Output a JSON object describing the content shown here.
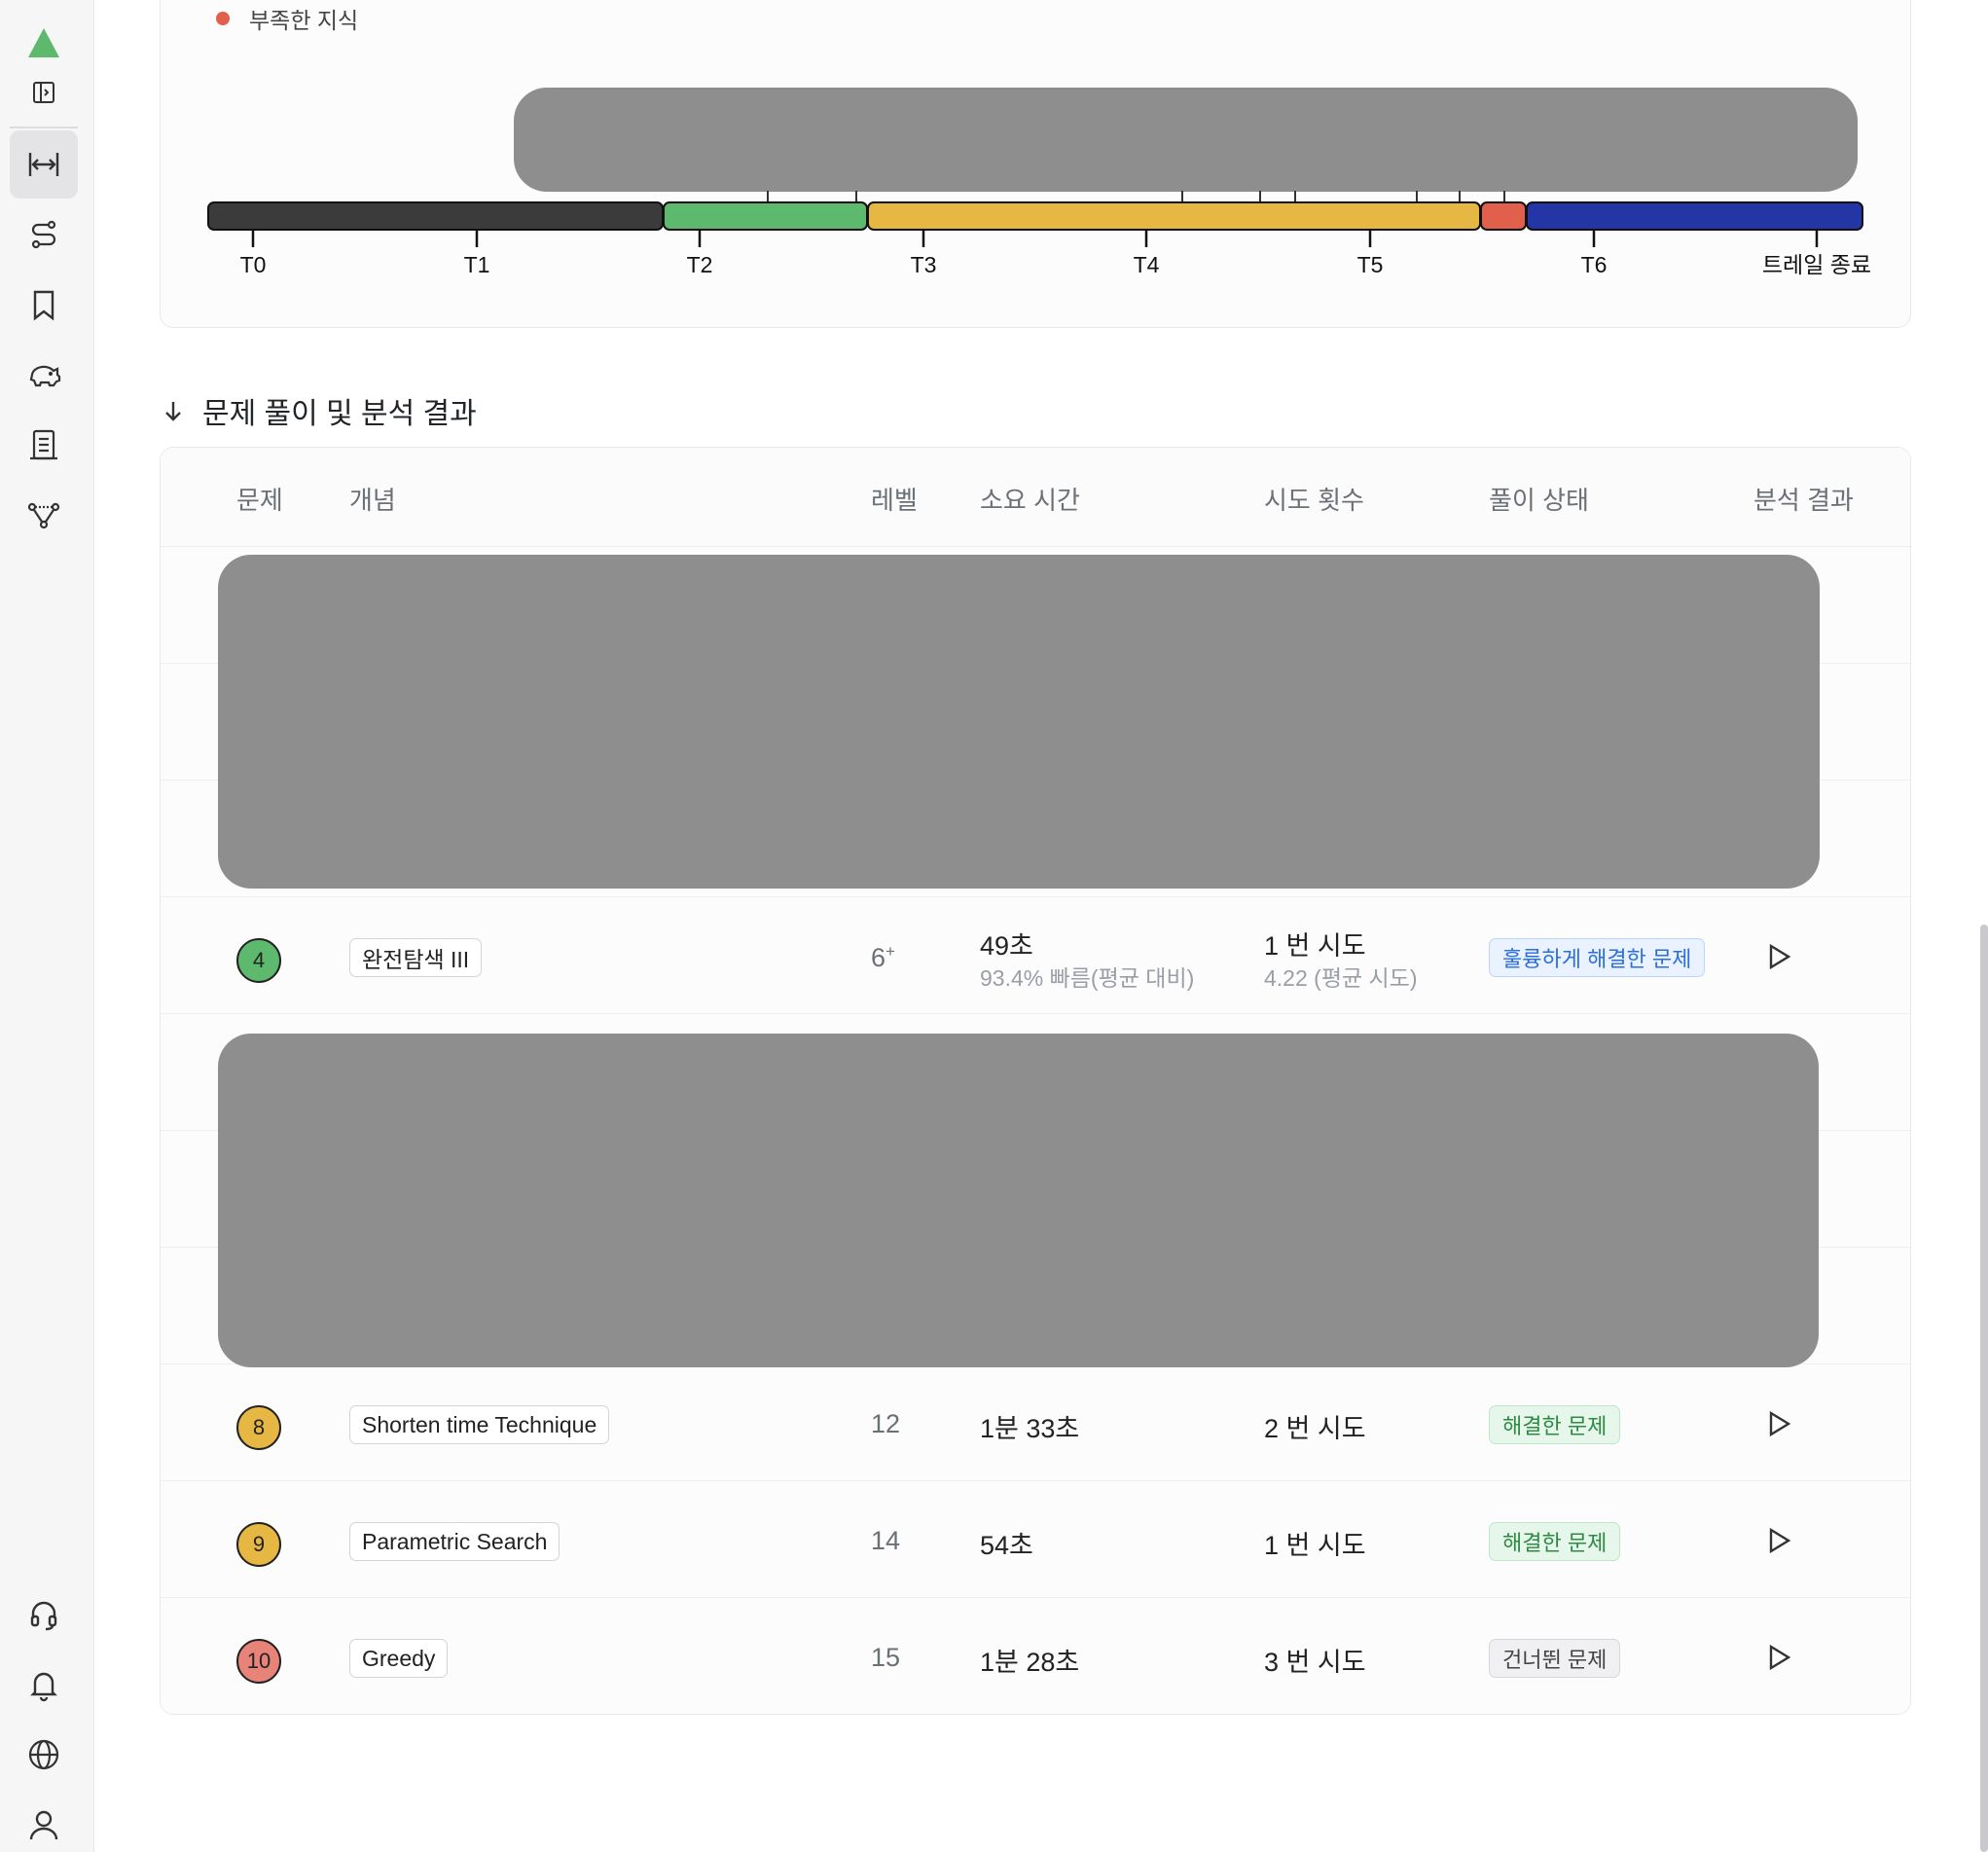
{
  "sidebar": {
    "icons": [
      {
        "name": "logo-triangle-icon",
        "color": "#5cb96d"
      },
      {
        "name": "panel-toggle-icon"
      },
      {
        "name": "fit-width-icon",
        "active": true
      },
      {
        "name": "route-icon"
      },
      {
        "name": "bookmark-icon"
      },
      {
        "name": "piggy-bank-icon"
      },
      {
        "name": "report-icon"
      },
      {
        "name": "network-icon"
      },
      {
        "name": "headset-icon"
      },
      {
        "name": "bell-icon"
      },
      {
        "name": "globe-icon"
      },
      {
        "name": "user-icon"
      }
    ]
  },
  "timeline": {
    "legend_label": "부족한 지식",
    "segments": [
      {
        "stage": "T0–T2",
        "color": "#3b3b3b"
      },
      {
        "stage": "T2–T3",
        "color": "#5cb96d"
      },
      {
        "stage": "T3–T5",
        "color": "#e6b843"
      },
      {
        "stage": "T5",
        "color": "#e0604c"
      },
      {
        "stage": "T6",
        "color": "#2435a6"
      }
    ],
    "ticks": [
      "T0",
      "T1",
      "T2",
      "T3",
      "T4",
      "T5",
      "T6",
      "트레일 종료"
    ]
  },
  "section": {
    "title": "문제 풀이 및 분석 결과"
  },
  "table": {
    "headers": {
      "problem": "문제",
      "concept": "개념",
      "level": "레벨",
      "time": "소요 시간",
      "tries": "시도 횟수",
      "status": "풀이 상태",
      "analysis": "분석 결과"
    },
    "rows": [
      {
        "number": "4",
        "badge_color": "#5cb96d",
        "concept": "완전탐색 III",
        "level": "6",
        "level_suffix": "+",
        "time": "49초",
        "time_note": "93.4% 빠름(평균 대비)",
        "tries": "1 번 시도",
        "tries_note": "4.22 (평균 시도)",
        "status": "훌륭하게 해결한 문제",
        "status_type": "excellent"
      },
      {
        "number": "8",
        "badge_color": "#e6b843",
        "concept": "Shorten time Technique",
        "level": "12",
        "time": "1분 33초",
        "tries": "2 번 시도",
        "status": "해결한 문제",
        "status_type": "solved"
      },
      {
        "number": "9",
        "badge_color": "#e6b843",
        "concept": "Parametric Search",
        "level": "14",
        "time": "54초",
        "tries": "1 번 시도",
        "status": "해결한 문제",
        "status_type": "solved"
      },
      {
        "number": "10",
        "badge_color": "#e8837a",
        "concept": "Greedy",
        "level": "15",
        "time": "1분 28초",
        "tries": "3 번 시도",
        "status": "건너뛴 문제",
        "status_type": "skipped"
      }
    ]
  }
}
